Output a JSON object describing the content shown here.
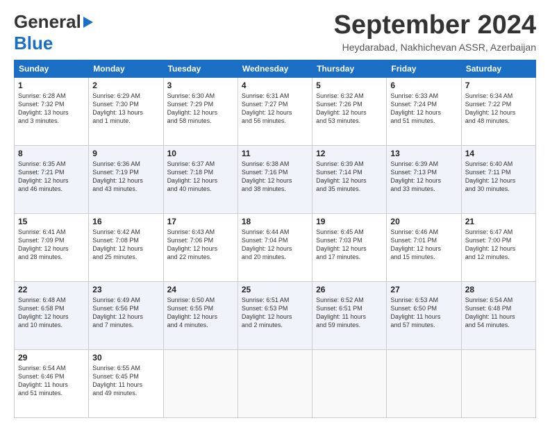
{
  "header": {
    "logo": {
      "general": "General",
      "blue": "Blue"
    },
    "title": "September 2024",
    "location": "Heydarabad, Nakhichevan ASSR, Azerbaijan"
  },
  "calendar": {
    "days_of_week": [
      "Sunday",
      "Monday",
      "Tuesday",
      "Wednesday",
      "Thursday",
      "Friday",
      "Saturday"
    ],
    "weeks": [
      [
        {
          "day": "1",
          "info": "Sunrise: 6:28 AM\nSunset: 7:32 PM\nDaylight: 13 hours\nand 3 minutes."
        },
        {
          "day": "2",
          "info": "Sunrise: 6:29 AM\nSunset: 7:30 PM\nDaylight: 13 hours\nand 1 minute."
        },
        {
          "day": "3",
          "info": "Sunrise: 6:30 AM\nSunset: 7:29 PM\nDaylight: 12 hours\nand 58 minutes."
        },
        {
          "day": "4",
          "info": "Sunrise: 6:31 AM\nSunset: 7:27 PM\nDaylight: 12 hours\nand 56 minutes."
        },
        {
          "day": "5",
          "info": "Sunrise: 6:32 AM\nSunset: 7:26 PM\nDaylight: 12 hours\nand 53 minutes."
        },
        {
          "day": "6",
          "info": "Sunrise: 6:33 AM\nSunset: 7:24 PM\nDaylight: 12 hours\nand 51 minutes."
        },
        {
          "day": "7",
          "info": "Sunrise: 6:34 AM\nSunset: 7:22 PM\nDaylight: 12 hours\nand 48 minutes."
        }
      ],
      [
        {
          "day": "8",
          "info": "Sunrise: 6:35 AM\nSunset: 7:21 PM\nDaylight: 12 hours\nand 46 minutes."
        },
        {
          "day": "9",
          "info": "Sunrise: 6:36 AM\nSunset: 7:19 PM\nDaylight: 12 hours\nand 43 minutes."
        },
        {
          "day": "10",
          "info": "Sunrise: 6:37 AM\nSunset: 7:18 PM\nDaylight: 12 hours\nand 40 minutes."
        },
        {
          "day": "11",
          "info": "Sunrise: 6:38 AM\nSunset: 7:16 PM\nDaylight: 12 hours\nand 38 minutes."
        },
        {
          "day": "12",
          "info": "Sunrise: 6:39 AM\nSunset: 7:14 PM\nDaylight: 12 hours\nand 35 minutes."
        },
        {
          "day": "13",
          "info": "Sunrise: 6:39 AM\nSunset: 7:13 PM\nDaylight: 12 hours\nand 33 minutes."
        },
        {
          "day": "14",
          "info": "Sunrise: 6:40 AM\nSunset: 7:11 PM\nDaylight: 12 hours\nand 30 minutes."
        }
      ],
      [
        {
          "day": "15",
          "info": "Sunrise: 6:41 AM\nSunset: 7:09 PM\nDaylight: 12 hours\nand 28 minutes."
        },
        {
          "day": "16",
          "info": "Sunrise: 6:42 AM\nSunset: 7:08 PM\nDaylight: 12 hours\nand 25 minutes."
        },
        {
          "day": "17",
          "info": "Sunrise: 6:43 AM\nSunset: 7:06 PM\nDaylight: 12 hours\nand 22 minutes."
        },
        {
          "day": "18",
          "info": "Sunrise: 6:44 AM\nSunset: 7:04 PM\nDaylight: 12 hours\nand 20 minutes."
        },
        {
          "day": "19",
          "info": "Sunrise: 6:45 AM\nSunset: 7:03 PM\nDaylight: 12 hours\nand 17 minutes."
        },
        {
          "day": "20",
          "info": "Sunrise: 6:46 AM\nSunset: 7:01 PM\nDaylight: 12 hours\nand 15 minutes."
        },
        {
          "day": "21",
          "info": "Sunrise: 6:47 AM\nSunset: 7:00 PM\nDaylight: 12 hours\nand 12 minutes."
        }
      ],
      [
        {
          "day": "22",
          "info": "Sunrise: 6:48 AM\nSunset: 6:58 PM\nDaylight: 12 hours\nand 10 minutes."
        },
        {
          "day": "23",
          "info": "Sunrise: 6:49 AM\nSunset: 6:56 PM\nDaylight: 12 hours\nand 7 minutes."
        },
        {
          "day": "24",
          "info": "Sunrise: 6:50 AM\nSunset: 6:55 PM\nDaylight: 12 hours\nand 4 minutes."
        },
        {
          "day": "25",
          "info": "Sunrise: 6:51 AM\nSunset: 6:53 PM\nDaylight: 12 hours\nand 2 minutes."
        },
        {
          "day": "26",
          "info": "Sunrise: 6:52 AM\nSunset: 6:51 PM\nDaylight: 11 hours\nand 59 minutes."
        },
        {
          "day": "27",
          "info": "Sunrise: 6:53 AM\nSunset: 6:50 PM\nDaylight: 11 hours\nand 57 minutes."
        },
        {
          "day": "28",
          "info": "Sunrise: 6:54 AM\nSunset: 6:48 PM\nDaylight: 11 hours\nand 54 minutes."
        }
      ],
      [
        {
          "day": "29",
          "info": "Sunrise: 6:54 AM\nSunset: 6:46 PM\nDaylight: 11 hours\nand 51 minutes."
        },
        {
          "day": "30",
          "info": "Sunrise: 6:55 AM\nSunset: 6:45 PM\nDaylight: 11 hours\nand 49 minutes."
        },
        {
          "day": "",
          "info": ""
        },
        {
          "day": "",
          "info": ""
        },
        {
          "day": "",
          "info": ""
        },
        {
          "day": "",
          "info": ""
        },
        {
          "day": "",
          "info": ""
        }
      ]
    ]
  }
}
